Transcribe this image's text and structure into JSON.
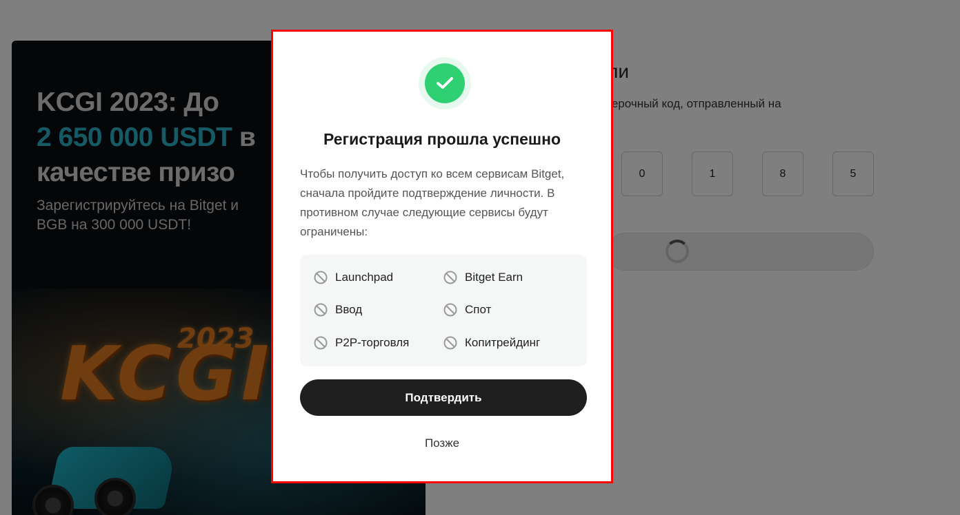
{
  "banner": {
    "title_line1": "KCGI 2023: До",
    "title_accent": "2 650 000 USDT",
    "title_line2_rest": " в",
    "title_line3": "качестве призо",
    "subtitle_line1": "Зарегистрируйтесь на Bitget и",
    "subtitle_line2": "BGB на 300 000 USDT!",
    "art_logo": "KCGI",
    "art_year": "2023"
  },
  "verification": {
    "title_fragment": "ли",
    "description_fragment": "верочный код, отправленный на",
    "code_digits": [
      "0",
      "1",
      "8",
      "5"
    ]
  },
  "modal": {
    "title": "Регистрация прошла успешно",
    "description": "Чтобы получить доступ ко всем сервисам Bitget, сначала пройдите подтверждение личности. В противном случае следующие сервисы будут ограничены:",
    "restricted_services": [
      {
        "label": "Launchpad",
        "icon": "prohibited-icon"
      },
      {
        "label": "Bitget Earn",
        "icon": "prohibited-icon"
      },
      {
        "label": "Ввод",
        "icon": "prohibited-icon"
      },
      {
        "label": "Спот",
        "icon": "prohibited-icon"
      },
      {
        "label": "P2P-торговля",
        "icon": "prohibited-icon"
      },
      {
        "label": "Копитрейдинг",
        "icon": "prohibited-icon"
      }
    ],
    "confirm_label": "Подтвердить",
    "later_label": "Позже",
    "success_icon": "checkmark-icon"
  },
  "colors": {
    "success_green": "#2fd072",
    "accent_teal": "#2bb5c8",
    "highlight_border": "#ff0000",
    "button_dark": "#1f1f1f"
  }
}
